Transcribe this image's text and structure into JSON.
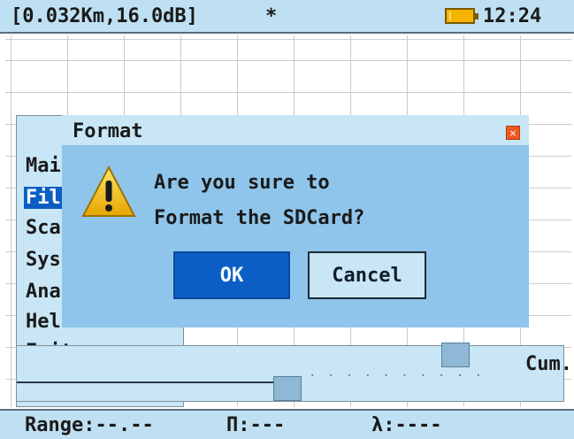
{
  "status": {
    "readout": "[0.032Km,16.0dB]",
    "marker": "*",
    "time": "12:24",
    "battery_icon": "battery-icon"
  },
  "menu": {
    "items": [
      {
        "label": "Mai"
      },
      {
        "label": "Fil"
      },
      {
        "label": "Sca"
      },
      {
        "label": "Sys"
      },
      {
        "label": "Ana"
      },
      {
        "label": "Hel"
      },
      {
        "label": "Exit"
      }
    ]
  },
  "panel": {
    "cum_label": "Cum."
  },
  "dialog": {
    "title": "Format",
    "line1": "Are you sure to",
    "line2": "Format the SDCard?",
    "ok_label": "OK",
    "cancel_label": "Cancel"
  },
  "footer": {
    "range": "Range:--.--",
    "pulse": "П:---",
    "lambda": "λ:----"
  },
  "colors": {
    "accent": "#0b5fc4",
    "dialog_bg": "#8fc5ea",
    "bar_bg": "#bfe0f2"
  }
}
